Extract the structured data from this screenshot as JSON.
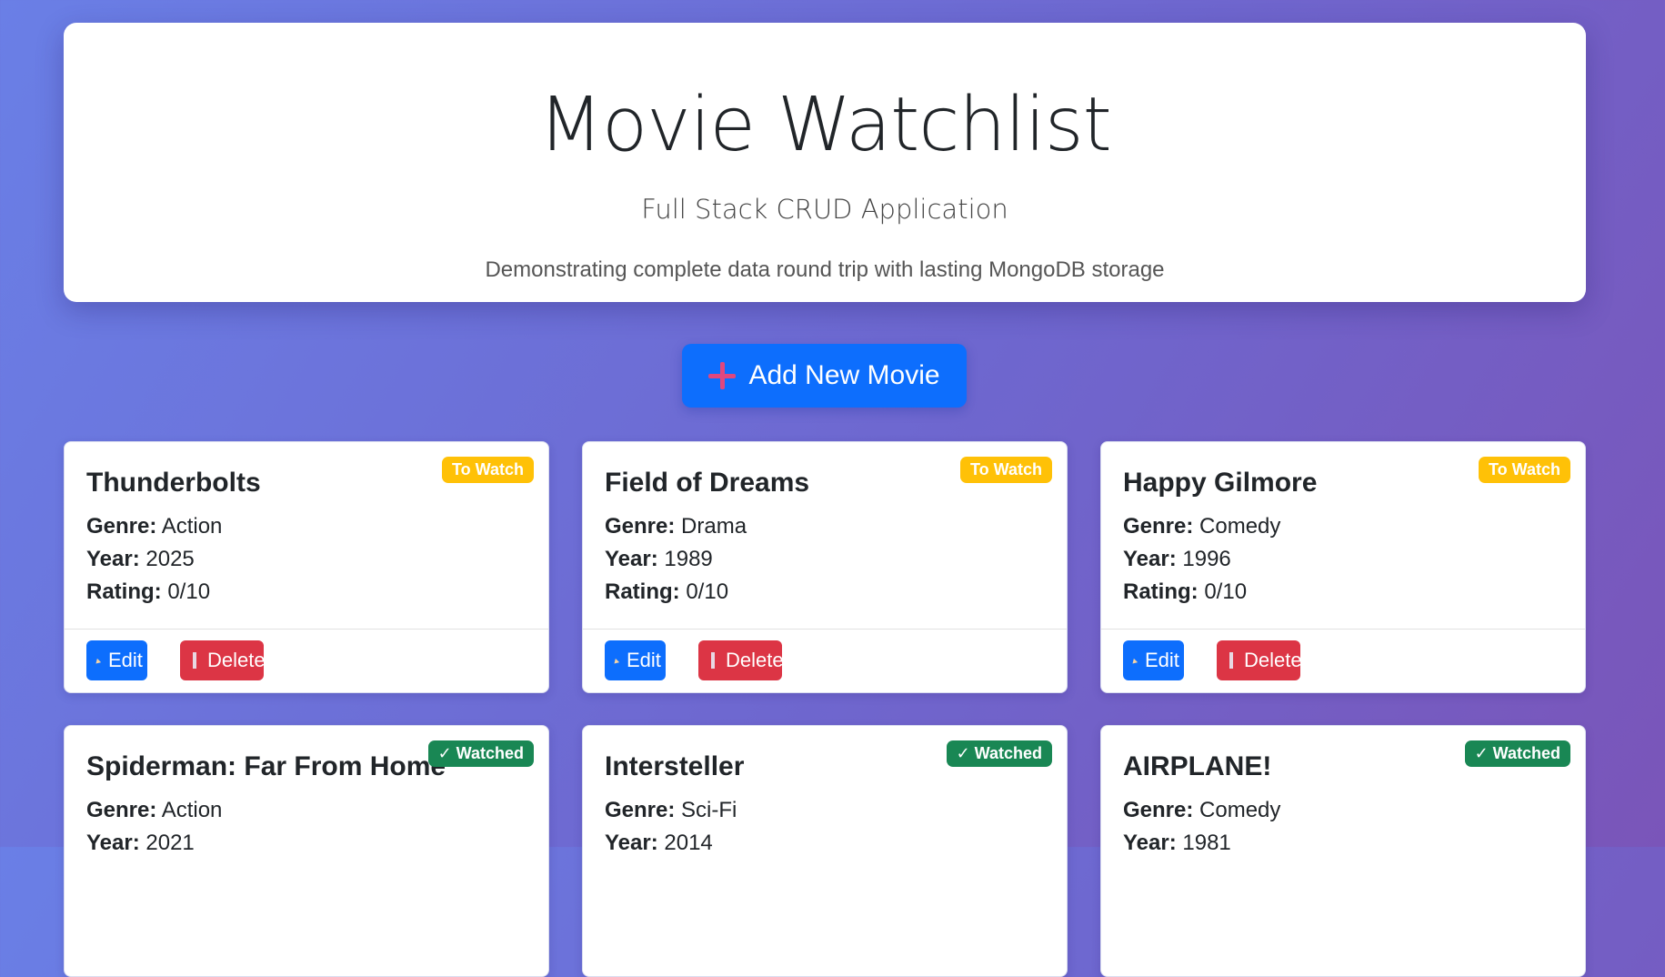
{
  "header": {
    "title": "Movie Watchlist",
    "subtitle": "Full Stack CRUD Application",
    "description": "Demonstrating complete data round trip with lasting MongoDB storage"
  },
  "add_button": {
    "label": "Add New Movie",
    "icon": "plus-icon"
  },
  "labels": {
    "genre": "Genre:",
    "year": "Year:",
    "rating": "Rating:",
    "edit": "Edit",
    "delete": "Delete"
  },
  "movies": [
    {
      "title": "Thunderbolts",
      "status": "To Watch",
      "genre": "Action",
      "year": "2025",
      "rating": "0/10"
    },
    {
      "title": "Field of Dreams",
      "status": "To Watch",
      "genre": "Drama",
      "year": "1989",
      "rating": "0/10"
    },
    {
      "title": "Happy Gilmore",
      "status": "To Watch",
      "genre": "Comedy",
      "year": "1996",
      "rating": "0/10"
    },
    {
      "title": "Spiderman: Far From Home",
      "status": "✓ Watched",
      "genre": "Action",
      "year": "2021"
    },
    {
      "title": "Intersteller",
      "status": "✓ Watched",
      "genre": "Sci-Fi",
      "year": "2014"
    },
    {
      "title": "AIRPLANE!",
      "status": "✓ Watched",
      "genre": "Comedy",
      "year": "1981"
    }
  ],
  "colors": {
    "primary": "#0d6efd",
    "danger": "#dc3545",
    "warning": "#ffc107",
    "success": "#198754"
  }
}
